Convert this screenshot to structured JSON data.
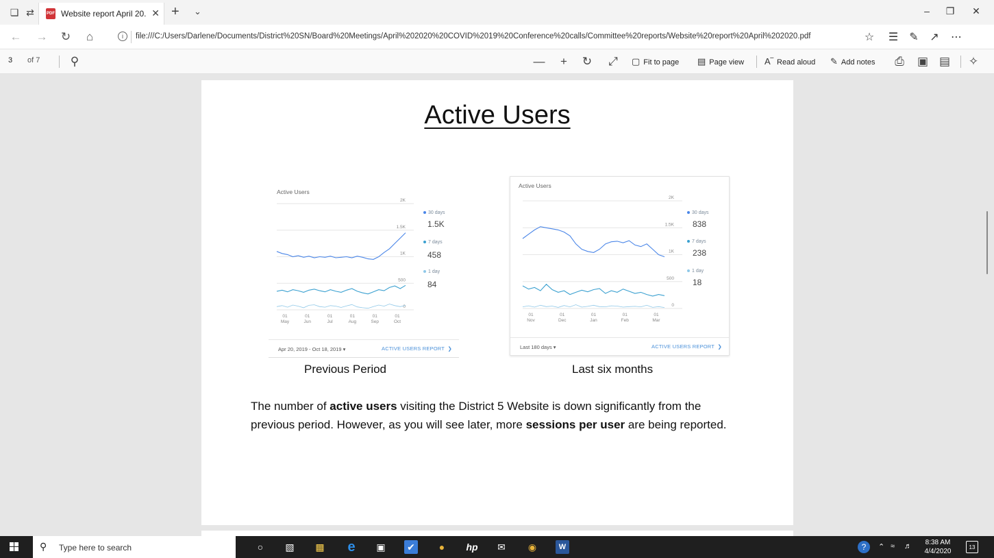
{
  "browser": {
    "tab_title": "Website report April 20.",
    "url": "file:///C:/Users/Darlene/Documents/District%20SN/Board%20Meetings/April%202020%20COVID%2019%20Conference%20calls/Committee%20reports/Website%20report%20April%202020.pdf"
  },
  "pdf_toolbar": {
    "page_number": "3",
    "page_count": "of 7",
    "fit_to_page": "Fit to page",
    "page_view": "Page view",
    "read_aloud": "Read aloud",
    "add_notes": "Add notes"
  },
  "page": {
    "title": "Active Users",
    "caption_left": "Previous Period",
    "caption_right": "Last six months",
    "body_1": "The number of ",
    "body_bold_1": "active users",
    "body_2": " visiting the District 5 Website is down significantly from the previous period. However, as you will see later, more ",
    "body_bold_2": "sessions per user",
    "body_3": " are being reported."
  },
  "chart_data": [
    {
      "type": "line",
      "title": "Active Users",
      "x_tick_labels": [
        "01 May",
        "01 Jun",
        "01 Jul",
        "01 Aug",
        "01 Sep",
        "01 Oct"
      ],
      "y_tick_labels": [
        "2K",
        "1.5K",
        "1K",
        "500",
        "0"
      ],
      "ylim": [
        0,
        2000
      ],
      "legend": [
        {
          "name": "30 days",
          "value": "1.5K",
          "color": "#4a86e8"
        },
        {
          "name": "7 days",
          "value": "458",
          "color": "#3aa0d0"
        },
        {
          "name": "1 day",
          "value": "84",
          "color": "#8fc8e8"
        }
      ],
      "date_range": "Apr 20, 2019 - Oct 18, 2019",
      "link": "ACTIVE USERS REPORT",
      "series": [
        {
          "name": "30 days",
          "values": [
            1100,
            1060,
            1040,
            1000,
            1020,
            990,
            1010,
            980,
            1000,
            990,
            1010,
            980,
            990,
            1000,
            980,
            1010,
            990,
            960,
            950,
            1000,
            1080,
            1150,
            1250,
            1350,
            1450
          ]
        },
        {
          "name": "7 days",
          "values": [
            350,
            370,
            340,
            380,
            360,
            330,
            370,
            390,
            360,
            340,
            380,
            350,
            330,
            370,
            400,
            350,
            320,
            300,
            340,
            380,
            360,
            420,
            450,
            400,
            460
          ]
        },
        {
          "name": "1 day",
          "values": [
            60,
            80,
            50,
            90,
            70,
            40,
            85,
            95,
            60,
            50,
            80,
            70,
            45,
            75,
            100,
            55,
            40,
            30,
            60,
            90,
            70,
            110,
            80,
            60,
            84
          ]
        }
      ]
    },
    {
      "type": "line",
      "title": "Active Users",
      "x_tick_labels": [
        "01 Nov",
        "01 Dec",
        "01 Jan",
        "01 Feb",
        "01 Mar"
      ],
      "y_tick_labels": [
        "2K",
        "1.5K",
        "1K",
        "500",
        "0"
      ],
      "ylim": [
        0,
        2000
      ],
      "legend": [
        {
          "name": "30 days",
          "value": "838",
          "color": "#4a86e8"
        },
        {
          "name": "7 days",
          "value": "238",
          "color": "#3aa0d0"
        },
        {
          "name": "1 day",
          "value": "18",
          "color": "#8fc8e8"
        }
      ],
      "date_range": "Last 180 days",
      "link": "ACTIVE USERS REPORT",
      "series": [
        {
          "name": "30 days",
          "values": [
            1300,
            1380,
            1460,
            1520,
            1500,
            1480,
            1460,
            1420,
            1350,
            1200,
            1100,
            1060,
            1040,
            1100,
            1200,
            1240,
            1250,
            1220,
            1260,
            1180,
            1150,
            1200,
            1100,
            1000,
            960
          ]
        },
        {
          "name": "7 days",
          "values": [
            420,
            360,
            390,
            330,
            450,
            350,
            300,
            330,
            260,
            300,
            340,
            310,
            350,
            370,
            280,
            330,
            300,
            360,
            320,
            280,
            300,
            260,
            230,
            260,
            238
          ]
        },
        {
          "name": "1 day",
          "values": [
            30,
            50,
            25,
            60,
            35,
            45,
            20,
            55,
            30,
            70,
            25,
            40,
            60,
            35,
            30,
            50,
            45,
            25,
            35,
            40,
            30,
            60,
            20,
            35,
            18
          ]
        }
      ]
    }
  ],
  "taskbar": {
    "search_placeholder": "Type here to search",
    "time": "8:38 AM",
    "date": "4/4/2020",
    "notification_count": "13"
  }
}
